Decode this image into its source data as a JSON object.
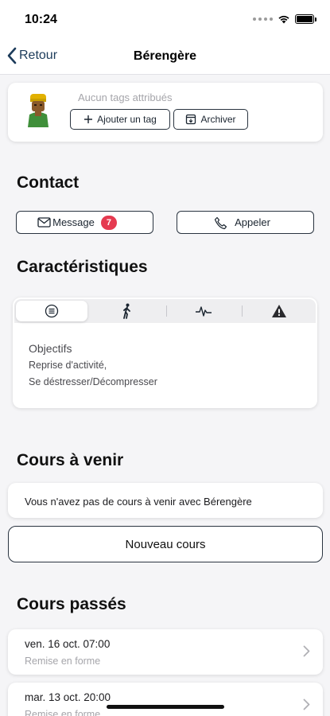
{
  "status": {
    "time": "10:24"
  },
  "nav": {
    "back_label": "Retour",
    "title": "Bérengère"
  },
  "profile": {
    "no_tags": "Aucun tags attribués",
    "add_tag_label": "Ajouter un tag",
    "archive_label": "Archiver"
  },
  "contact": {
    "title": "Contact",
    "message_label": "Message",
    "message_count": "7",
    "call_label": "Appeler"
  },
  "caracteristiques": {
    "title": "Caractéristiques",
    "objectives_label": "Objectifs",
    "objectives": [
      "Reprise d'activité,",
      "Se déstresser/Décompresser"
    ]
  },
  "upcoming": {
    "title": "Cours à venir",
    "empty_text": "Vous n'avez pas de cours à venir avec Bérengère",
    "new_course_label": "Nouveau cours"
  },
  "past": {
    "title": "Cours passés",
    "items": [
      {
        "date": "ven. 16 oct. 07:00",
        "type": "Remise en forme"
      },
      {
        "date": "mar. 13 oct. 20:00",
        "type": "Remise en forme"
      }
    ]
  },
  "colors": {
    "accent": "#1c3b5a",
    "badge": "#e53a50",
    "outline": "#2a3440"
  }
}
